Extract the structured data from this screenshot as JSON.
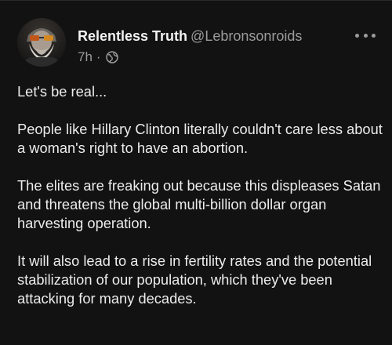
{
  "post": {
    "display_name": "Relentless Truth",
    "handle": "@Lebronsonroids",
    "time": "7h",
    "separator": "·",
    "visibility_icon": "globe-icon",
    "more_icon": "more-dots-icon",
    "avatar_icon": "avatar-bearded-man-sunglasses",
    "paragraphs": [
      "Let's be real...",
      "People like Hillary Clinton literally couldn't care less about a woman's right to have an abortion.",
      "The elites are freaking out because this displeases Satan and threatens the global multi-billion dollar organ harvesting operation.",
      "It will also lead to a rise in fertility rates and the potential stabilization of our population, which they've been attacking for many decades."
    ]
  },
  "colors": {
    "background": "#121212",
    "text": "#ececec",
    "secondary": "#9b9b9b"
  }
}
